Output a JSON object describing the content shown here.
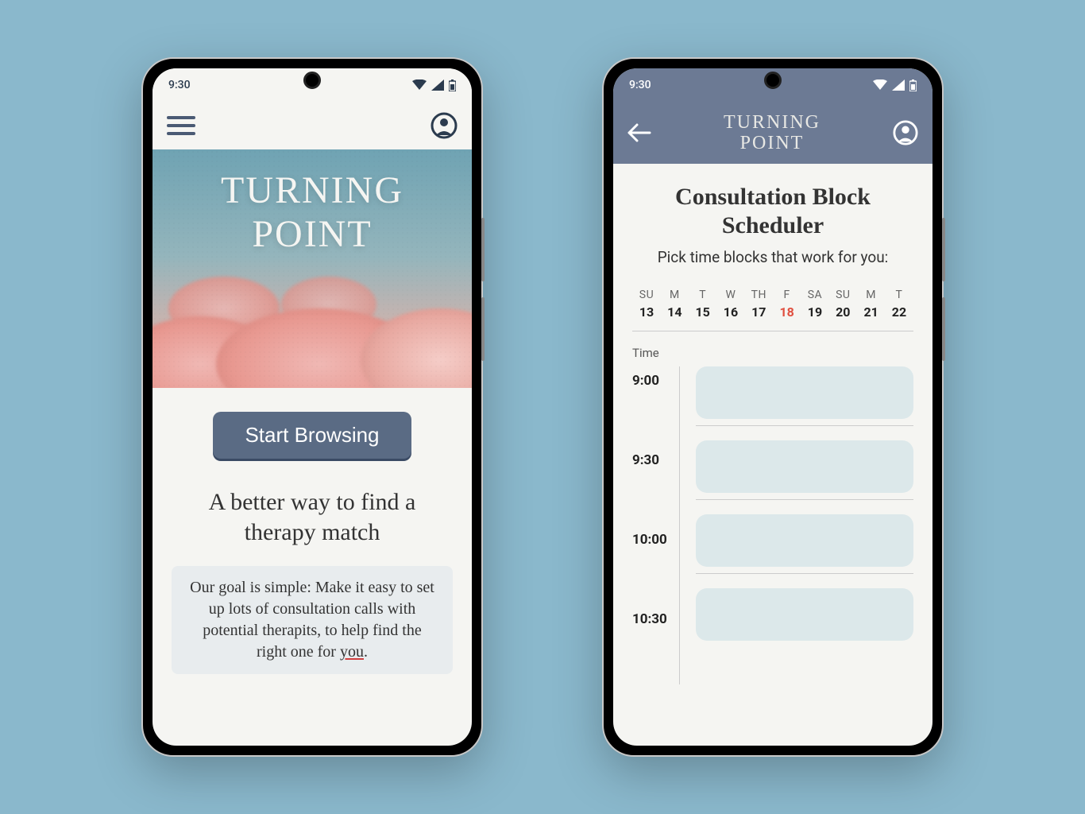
{
  "status": {
    "time": "9:30"
  },
  "phone1": {
    "hero_title_line1": "TURNING",
    "hero_title_line2": "POINT",
    "start_button": "Start Browsing",
    "headline": "A better way to find a therapy match",
    "blurb_pre": "Our goal is simple: Make it easy to set up lots of consultation calls with potential therapits, to help find the right one for ",
    "blurb_underlined": "you",
    "blurb_post": "."
  },
  "phone2": {
    "header_title_line1": "TURNING",
    "header_title_line2": "POINT",
    "page_title": "Consultation Block Scheduler",
    "subtitle": "Pick time blocks that work for you:",
    "calendar": {
      "day_labels": [
        "SU",
        "M",
        "T",
        "W",
        "TH",
        "F",
        "SA",
        "SU",
        "M",
        "T"
      ],
      "day_numbers": [
        "13",
        "14",
        "15",
        "16",
        "17",
        "18",
        "19",
        "20",
        "21",
        "22"
      ],
      "selected_index": 5
    },
    "time_header": "Time",
    "time_slots": [
      "9:00",
      "9:30",
      "10:00",
      "10:30"
    ]
  },
  "colors": {
    "bg": "#8ab8cc",
    "primary": "#5a6b84",
    "header_dark": "#6c7a94",
    "accent": "#e05040"
  }
}
